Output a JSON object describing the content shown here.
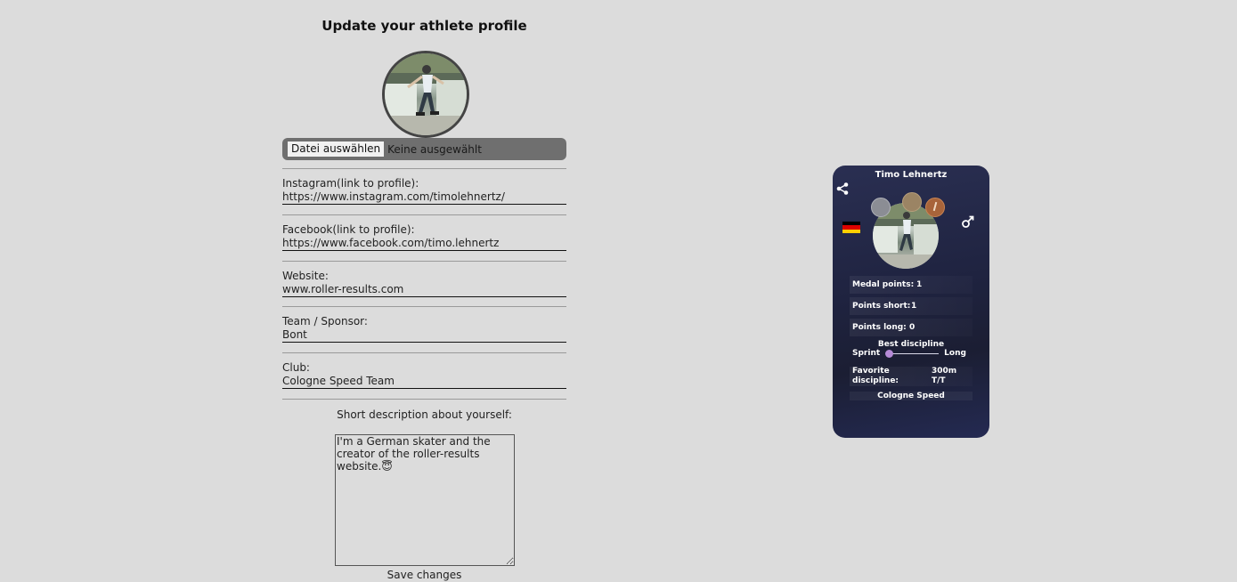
{
  "form": {
    "title": "Update your athlete profile",
    "file_button_label": "Datei auswählen",
    "file_status": "Keine ausgewählt",
    "fields": [
      {
        "label": "Instagram(link to profile):",
        "value": "https://www.instagram.com/timolehnertz/"
      },
      {
        "label": "Facebook(link to profile):",
        "value": "https://www.facebook.com/timo.lehnertz"
      },
      {
        "label": "Website:",
        "value": "www.roller-results.com"
      },
      {
        "label": "Team / Sponsor:",
        "value": "Bont"
      },
      {
        "label": "Club:",
        "value": "Cologne Speed Team"
      }
    ],
    "description_label": "Short description about yourself:",
    "description_value": "I'm a German skater and the creator of the roller-results website.😇",
    "save_label": "Save changes"
  },
  "card": {
    "name": "Timo Lehnertz",
    "share_icon": "share-icon",
    "gender_icon": "male-icon",
    "flag_colors": [
      "#000000",
      "#dd0000",
      "#ffce00"
    ],
    "medal_colors": {
      "silver": "#8b8d94",
      "gold": "#9b8464",
      "bronze": "#a8643a"
    },
    "stats": [
      {
        "label": "Medal points:",
        "value": "1"
      },
      {
        "label": "Points short:",
        "value": "1"
      },
      {
        "label": "Points long:",
        "value": "0"
      }
    ],
    "best_discipline": {
      "title": "Best discipline",
      "left_label": "Sprint",
      "right_label": "Long",
      "level": 0.0
    },
    "favorite": {
      "label_line1": "Favorite",
      "label_line2": "discipline:",
      "value_line1": "300m",
      "value_line2": "T/T"
    },
    "club": "Cologne Speed"
  }
}
